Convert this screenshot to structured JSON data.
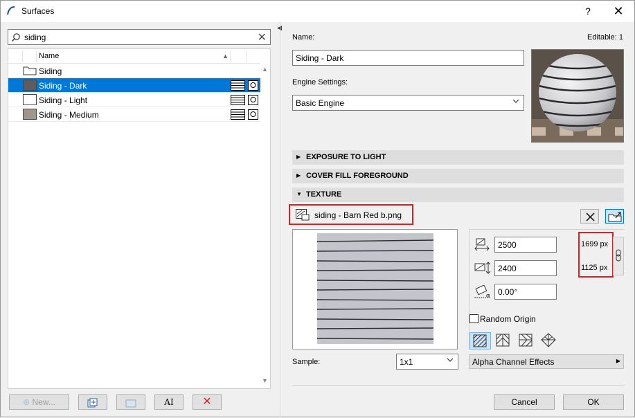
{
  "window": {
    "title": "Surfaces",
    "help_label": "?",
    "close_label": "✕"
  },
  "search": {
    "value": "siding",
    "icon": "search-icon",
    "clear_label": "✕"
  },
  "list": {
    "column_name": "Name",
    "rows": [
      {
        "label": "Siding",
        "type": "folder"
      },
      {
        "label": "Siding - Dark",
        "color": "#5e5c5c",
        "selected": true
      },
      {
        "label": "Siding - Light",
        "color": "#ffffff"
      },
      {
        "label": "Siding - Medium",
        "color": "#a0968a"
      }
    ]
  },
  "bottom_buttons": {
    "new_label": "New..."
  },
  "name": {
    "label": "Name:",
    "value": "Siding - Dark",
    "editable": "Editable: 1"
  },
  "engine": {
    "label": "Engine Settings:",
    "value": "Basic Engine"
  },
  "sections": {
    "exposure": "EXPOSURE TO LIGHT",
    "cover_fill": "COVER FILL FOREGROUND",
    "texture": "TEXTURE"
  },
  "texture": {
    "file_name": "siding - Barn Red b.png",
    "width": "2500",
    "height": "2400",
    "angle": "0.00°",
    "width_px": "1699 px",
    "height_px": "1125 px",
    "random_origin": "Random Origin",
    "sample_label": "Sample:",
    "sample_value": "1x1",
    "alpha_label": "Alpha Channel Effects"
  },
  "dialog": {
    "cancel_label": "Cancel",
    "ok_label": "OK"
  },
  "colors": {
    "selection": "#0078d7",
    "highlight": "#e02020"
  }
}
